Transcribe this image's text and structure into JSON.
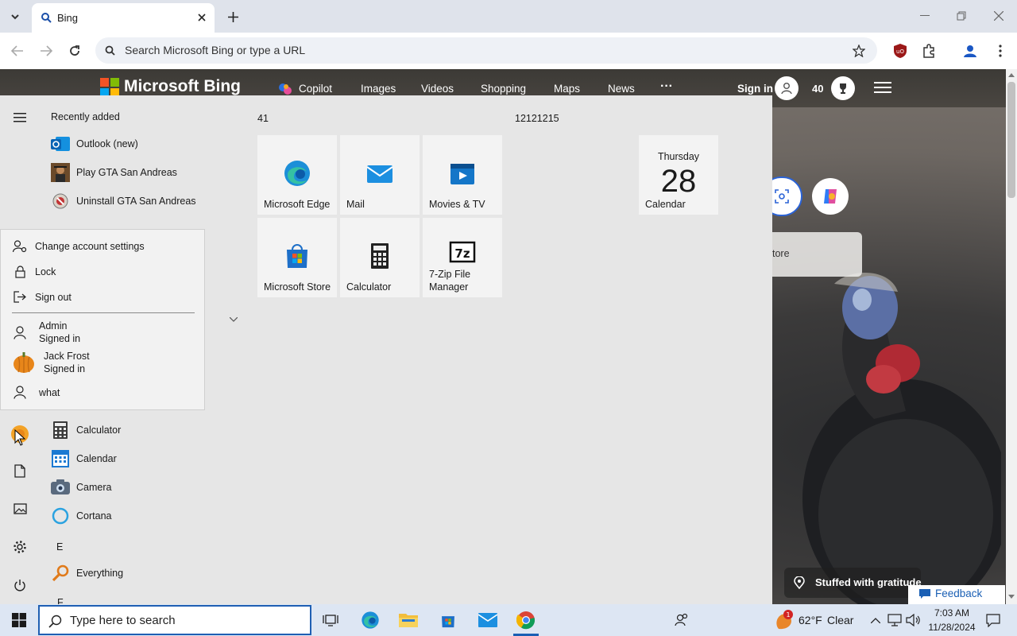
{
  "browser": {
    "tab_title": "Bing",
    "omnibox_placeholder": "Search Microsoft Bing or type a URL"
  },
  "bing": {
    "logo_text": "Microsoft Bing",
    "nav": [
      "Copilot",
      "Images",
      "Videos",
      "Shopping",
      "Maps",
      "News"
    ],
    "more": "···",
    "sign_in": "Sign in",
    "rewards_count": "40",
    "caption": "Stuffed with gratitude",
    "store_fragment": "tore",
    "feedback": "Feedback"
  },
  "start": {
    "recently_added_label": "Recently added",
    "partial_label": "Expand",
    "recent": [
      {
        "label": "Outlook (new)",
        "icon": "outlook-icon"
      },
      {
        "label": "Play GTA San Andreas",
        "icon": "gta-icon"
      },
      {
        "label": "Uninstall GTA San Andreas",
        "icon": "uninstall-icon"
      }
    ],
    "apps": [
      {
        "label": "Calculator",
        "icon": "calculator-icon"
      },
      {
        "label": "Calendar",
        "icon": "calendar-icon"
      },
      {
        "label": "Camera",
        "icon": "camera-icon"
      },
      {
        "label": "Cortana",
        "icon": "cortana-icon"
      }
    ],
    "letter_e": "E",
    "letter_f": "F",
    "everything": "Everything",
    "group1_title": "41",
    "group2_title": "12121215",
    "tiles": [
      {
        "label": "Microsoft Edge",
        "icon": "edge-icon"
      },
      {
        "label": "Mail",
        "icon": "mail-icon"
      },
      {
        "label": "Movies & TV",
        "icon": "movies-icon"
      },
      {
        "label": "Microsoft Store",
        "icon": "store-icon"
      },
      {
        "label": "Calculator",
        "icon": "calculator-icon"
      },
      {
        "label": "7-Zip File Manager",
        "icon": "7zip-icon"
      }
    ],
    "calendar_tile": {
      "day": "Thursday",
      "date": "28",
      "label": "Calendar"
    }
  },
  "account_menu": {
    "change_settings": "Change account settings",
    "lock": "Lock",
    "sign_out": "Sign out",
    "users": [
      {
        "name": "Admin",
        "status": "Signed in"
      },
      {
        "name": "Jack Frost",
        "status": "Signed in"
      },
      {
        "name": "what",
        "status": ""
      }
    ]
  },
  "taskbar": {
    "search_placeholder": "Type here to search",
    "temperature": "62°F",
    "condition": "Clear",
    "time": "7:03 AM",
    "date": "11/28/2024",
    "weather_badge": "1"
  },
  "colors": {
    "accent": "#0078d4",
    "taskbar": "#dde6f3"
  }
}
